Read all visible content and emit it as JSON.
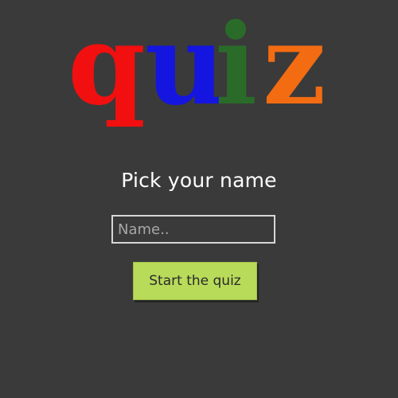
{
  "logo": {
    "letters": [
      "q",
      "u",
      "i",
      "z"
    ],
    "colors": [
      "#f20f0f",
      "#1515e0",
      "#2a6b2a",
      "#f36c12"
    ]
  },
  "prompt": {
    "title": "Pick your name"
  },
  "form": {
    "name_placeholder": "Name..",
    "name_value": "",
    "start_label": "Start the quiz"
  }
}
